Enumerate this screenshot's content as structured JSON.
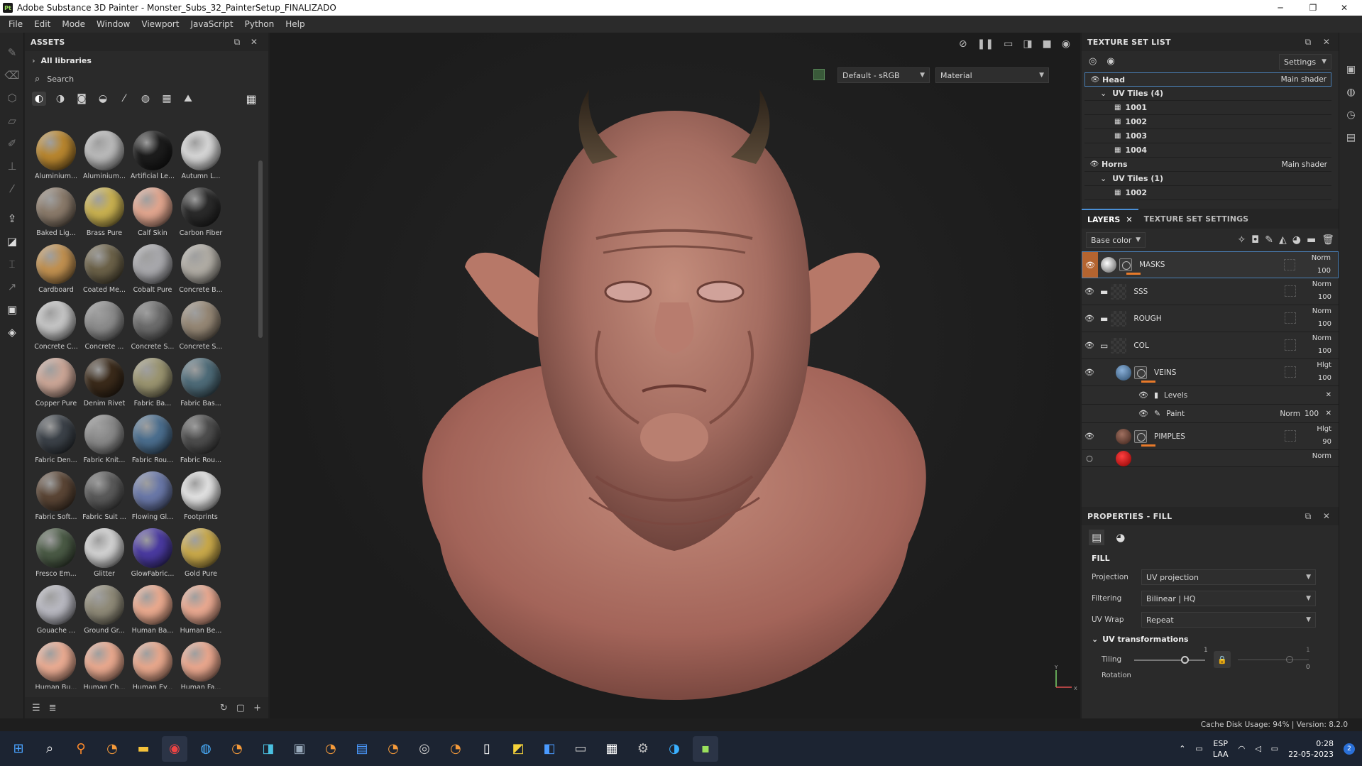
{
  "window": {
    "title": "Adobe Substance 3D Painter - Monster_Subs_32_PainterSetup_FINALIZADO",
    "app_badge": "Pt",
    "controls": [
      "─",
      "❐",
      "✕"
    ]
  },
  "menu": [
    "File",
    "Edit",
    "Mode",
    "Window",
    "Viewport",
    "JavaScript",
    "Python",
    "Help"
  ],
  "assets": {
    "title": "ASSETS",
    "libraries": "All libraries",
    "search_placeholder": "Search",
    "items": [
      {
        "name": "Aluminium...",
        "color": "#b8862f"
      },
      {
        "name": "Aluminium...",
        "color": "#b9b9b9"
      },
      {
        "name": "Artificial Le...",
        "color": "#1c1c1c"
      },
      {
        "name": "Autumn L...",
        "color": "#d5d5d5"
      },
      {
        "name": "Baked Lig...",
        "color": "#8a7a6a"
      },
      {
        "name": "Brass Pure",
        "color": "#c8b050"
      },
      {
        "name": "Calf Skin",
        "color": "#e0a58e"
      },
      {
        "name": "Carbon Fiber",
        "color": "#2a2a2a"
      },
      {
        "name": "Cardboard",
        "color": "#c09050"
      },
      {
        "name": "Coated Me...",
        "color": "#6b6148"
      },
      {
        "name": "Cobalt Pure",
        "color": "#a8a8ac"
      },
      {
        "name": "Concrete B...",
        "color": "#b0aca4"
      },
      {
        "name": "Concrete C...",
        "color": "#c4c4c4"
      },
      {
        "name": "Concrete ...",
        "color": "#8c8c8c"
      },
      {
        "name": "Concrete S...",
        "color": "#6c6c6c"
      },
      {
        "name": "Concrete S...",
        "color": "#958775"
      },
      {
        "name": "Copper Pure",
        "color": "#caa596"
      },
      {
        "name": "Denim Rivet",
        "color": "#3a2a1a"
      },
      {
        "name": "Fabric Ba...",
        "color": "#9a9470"
      },
      {
        "name": "Fabric Bas...",
        "color": "#4e6b78"
      },
      {
        "name": "Fabric Den...",
        "color": "#3b4148"
      },
      {
        "name": "Fabric Knit...",
        "color": "#8a8a8a"
      },
      {
        "name": "Fabric Rou...",
        "color": "#4b6e8e"
      },
      {
        "name": "Fabric Rou...",
        "color": "#4d4d4d"
      },
      {
        "name": "Fabric Soft...",
        "color": "#5a4535"
      },
      {
        "name": "Fabric Suit ...",
        "color": "#5a5a5a"
      },
      {
        "name": "Flowing Gl...",
        "color": "#6a78a8"
      },
      {
        "name": "Footprints",
        "color": "#e0e0e0"
      },
      {
        "name": "Fresco Em...",
        "color": "#4a5a45"
      },
      {
        "name": "Glitter",
        "color": "#d0d0d0"
      },
      {
        "name": "GlowFabric...",
        "color": "#4a3aa0"
      },
      {
        "name": "Gold Pure",
        "color": "#c8a84a"
      },
      {
        "name": "Gouache ...",
        "color": "#b8b8c0"
      },
      {
        "name": "Ground Gr...",
        "color": "#8f8a78"
      },
      {
        "name": "Human Ba...",
        "color": "#e9a98e"
      },
      {
        "name": "Human Be...",
        "color": "#e8a890"
      },
      {
        "name": "Human Bu...",
        "color": "#e9ab92"
      },
      {
        "name": "Human Ch...",
        "color": "#e8a88e"
      },
      {
        "name": "Human Ey...",
        "color": "#e7a78c"
      },
      {
        "name": "Human Fa...",
        "color": "#e8a68d"
      }
    ]
  },
  "viewport": {
    "color_profile": "Default - sRGB",
    "display_mode": "Material",
    "axis_y": "Y",
    "axis_x": "X"
  },
  "texture_set_list": {
    "title": "TEXTURE SET LIST",
    "settings_label": "Settings",
    "sets": [
      {
        "name": "Head",
        "shader": "Main shader",
        "uv_label": "UV Tiles (4)",
        "tiles": [
          "1001",
          "1002",
          "1003",
          "1004"
        ]
      },
      {
        "name": "Horns",
        "shader": "Main shader",
        "uv_label": "UV Tiles (1)",
        "tiles": [
          "1002"
        ]
      }
    ]
  },
  "layers_panel": {
    "tab_layers": "LAYERS",
    "tab_settings": "TEXTURE SET SETTINGS",
    "channel": "Base color",
    "layers": [
      {
        "name": "MASKS",
        "blend": "Norm",
        "opacity": "100"
      },
      {
        "name": "SSS",
        "blend": "Norm",
        "opacity": "100"
      },
      {
        "name": "ROUGH",
        "blend": "Norm",
        "opacity": "100"
      },
      {
        "name": "COL",
        "blend": "Norm",
        "opacity": "100"
      },
      {
        "name": "VEINS",
        "blend": "Hlgt",
        "opacity": "100"
      },
      {
        "name": "PIMPLES",
        "blend": "Hlgt",
        "opacity": "90"
      }
    ],
    "effects": {
      "levels": "Levels",
      "paint": "Paint",
      "paint_blend": "Norm",
      "paint_opacity": "100"
    },
    "last_blend": "Norm"
  },
  "properties": {
    "title": "PROPERTIES - FILL",
    "section": "FILL",
    "projection_label": "Projection",
    "projection": "UV projection",
    "filtering_label": "Filtering",
    "filtering": "Bilinear | HQ",
    "uvwrap_label": "UV Wrap",
    "uvwrap": "Repeat",
    "uv_transform": "UV transformations",
    "tiling_label": "Tiling",
    "tiling_value": "1",
    "tiling_value2": "1",
    "tiling_zero": "0",
    "rotation_label": "Rotation"
  },
  "status": {
    "cache": "Cache Disk Usage:",
    "cache_pct": "94%",
    "version": "Version: 8.2.0"
  },
  "taskbar": {
    "lang1": "ESP",
    "lang2": "LAA",
    "time": "0:28",
    "date": "22-05-2023",
    "badge": "2"
  }
}
